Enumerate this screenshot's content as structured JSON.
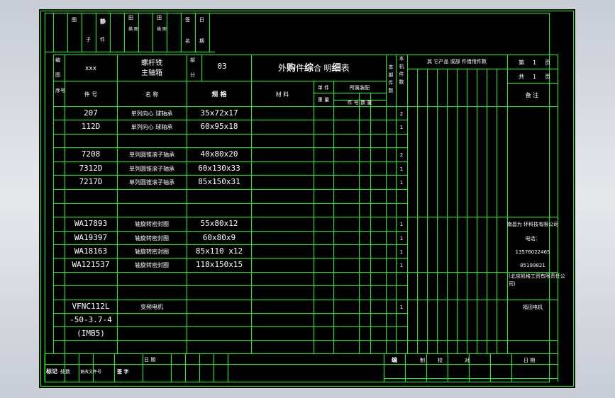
{
  "top_header": [
    {
      "text": "图"
    },
    {
      "text": "样",
      "sub": "子"
    },
    {
      "text": "静",
      "sub": "件"
    },
    {
      "text": "田",
      "sub": "辊 图 号",
      "sub2": "描 图"
    },
    {
      "text": "田",
      "sub": "辊 图 号",
      "sub2": "描 图"
    },
    {
      "text": "签",
      "sub": "名"
    },
    {
      "text": "日",
      "sub": "期"
    }
  ],
  "title_row": {
    "c1_top": "编",
    "c1_bot": "图",
    "c2": "xxx",
    "c3_line1": "螺杆铣",
    "c3_line2": "主轴箱",
    "c4_top": "部",
    "c4_bot": "分",
    "c5": "03",
    "title_pre": "外",
    "title_bold1": "购",
    "title_mid": "件",
    "title_bold2": "综",
    "title_mid2": "合 明",
    "title_bold3": "细",
    "title_post": "表",
    "col_qty_unit": "本部件数",
    "col_qty_machine": "本机件数",
    "col_other": "其 它产品 或部 件借用件数",
    "page_label": "第",
    "page_no": "1",
    "page_unit": "页",
    "total_label": "共",
    "total_no": "1",
    "total_unit": "页"
  },
  "col_headers": {
    "seq": "序号",
    "part_no": "件          号",
    "name": "名          称",
    "spec": "规          格",
    "material": "材          料",
    "unit_label": "单 件",
    "unit_weight": "重 量",
    "dept": "所属装配",
    "dept_sub": "件    号 数 量",
    "remark": "备          注"
  },
  "rows": [
    {
      "part": "207",
      "name": "单列向心 球轴承",
      "spec": "35x72x17",
      "qty": "2",
      "remark": ""
    },
    {
      "part": "112D",
      "name": "单列向心 球轴承",
      "spec": "60x95x18",
      "qty": "1",
      "remark": ""
    },
    {
      "part": "",
      "name": "",
      "spec": "",
      "qty": "",
      "remark": ""
    },
    {
      "part": "7208",
      "name": "单列圆锥滚子轴承",
      "spec": "40x80x20",
      "qty": "2",
      "remark": ""
    },
    {
      "part": "7312D",
      "name": "单列圆锥滚子轴承",
      "spec": "60x130x33",
      "qty": "1",
      "remark": ""
    },
    {
      "part": "7217D",
      "name": "单列圆锥滚子轴承",
      "spec": "85x150x31",
      "qty": "1",
      "remark": ""
    },
    {
      "part": "",
      "name": "",
      "spec": "",
      "qty": "",
      "remark": ""
    },
    {
      "part": "",
      "name": "",
      "spec": "",
      "qty": "",
      "remark": ""
    },
    {
      "part": "WA17893",
      "name": "轴旋转密封圈",
      "spec": "55x80x12",
      "qty": "1",
      "remark": "南昌为 环科技有限公司"
    },
    {
      "part": "WA19397",
      "name": "轴旋转密封圈",
      "spec": "60x80x9",
      "qty": "1",
      "remark": "电话："
    },
    {
      "part": "WA18163",
      "name": "轴旋转密封圈",
      "spec": "85x110 x12",
      "qty": "1",
      "remark": "13576022465"
    },
    {
      "part": "WA121537",
      "name": "轴旋转密封圈",
      "spec": "118x150x15",
      "qty": "1",
      "remark": "85199821"
    },
    {
      "part": "",
      "name": "",
      "spec": "",
      "qty": "",
      "remark": "(北京凯格工贸有限责任公司)"
    },
    {
      "part": "",
      "name": "",
      "spec": "",
      "qty": "",
      "remark": ""
    },
    {
      "part": "VFNC112L",
      "name": "变频电机",
      "spec": "",
      "qty": "1",
      "remark": "福田电机"
    },
    {
      "part": "-50-3.7-4",
      "name": "",
      "spec": "",
      "qty": "",
      "remark": ""
    },
    {
      "part": "(IMB5)",
      "name": "",
      "spec": "",
      "qty": "",
      "remark": ""
    }
  ],
  "footer": {
    "date_label": "日 期",
    "mark": "标记",
    "count": "处数",
    "change_doc": "更改文件号",
    "sign": "签  字",
    "compile": "编",
    "compile_sub": "制",
    "check": "校",
    "approve": "对",
    "date2": "日     期"
  },
  "colors": {
    "line": "#00ff00",
    "text": "#ffffff",
    "bg": "#000000"
  }
}
